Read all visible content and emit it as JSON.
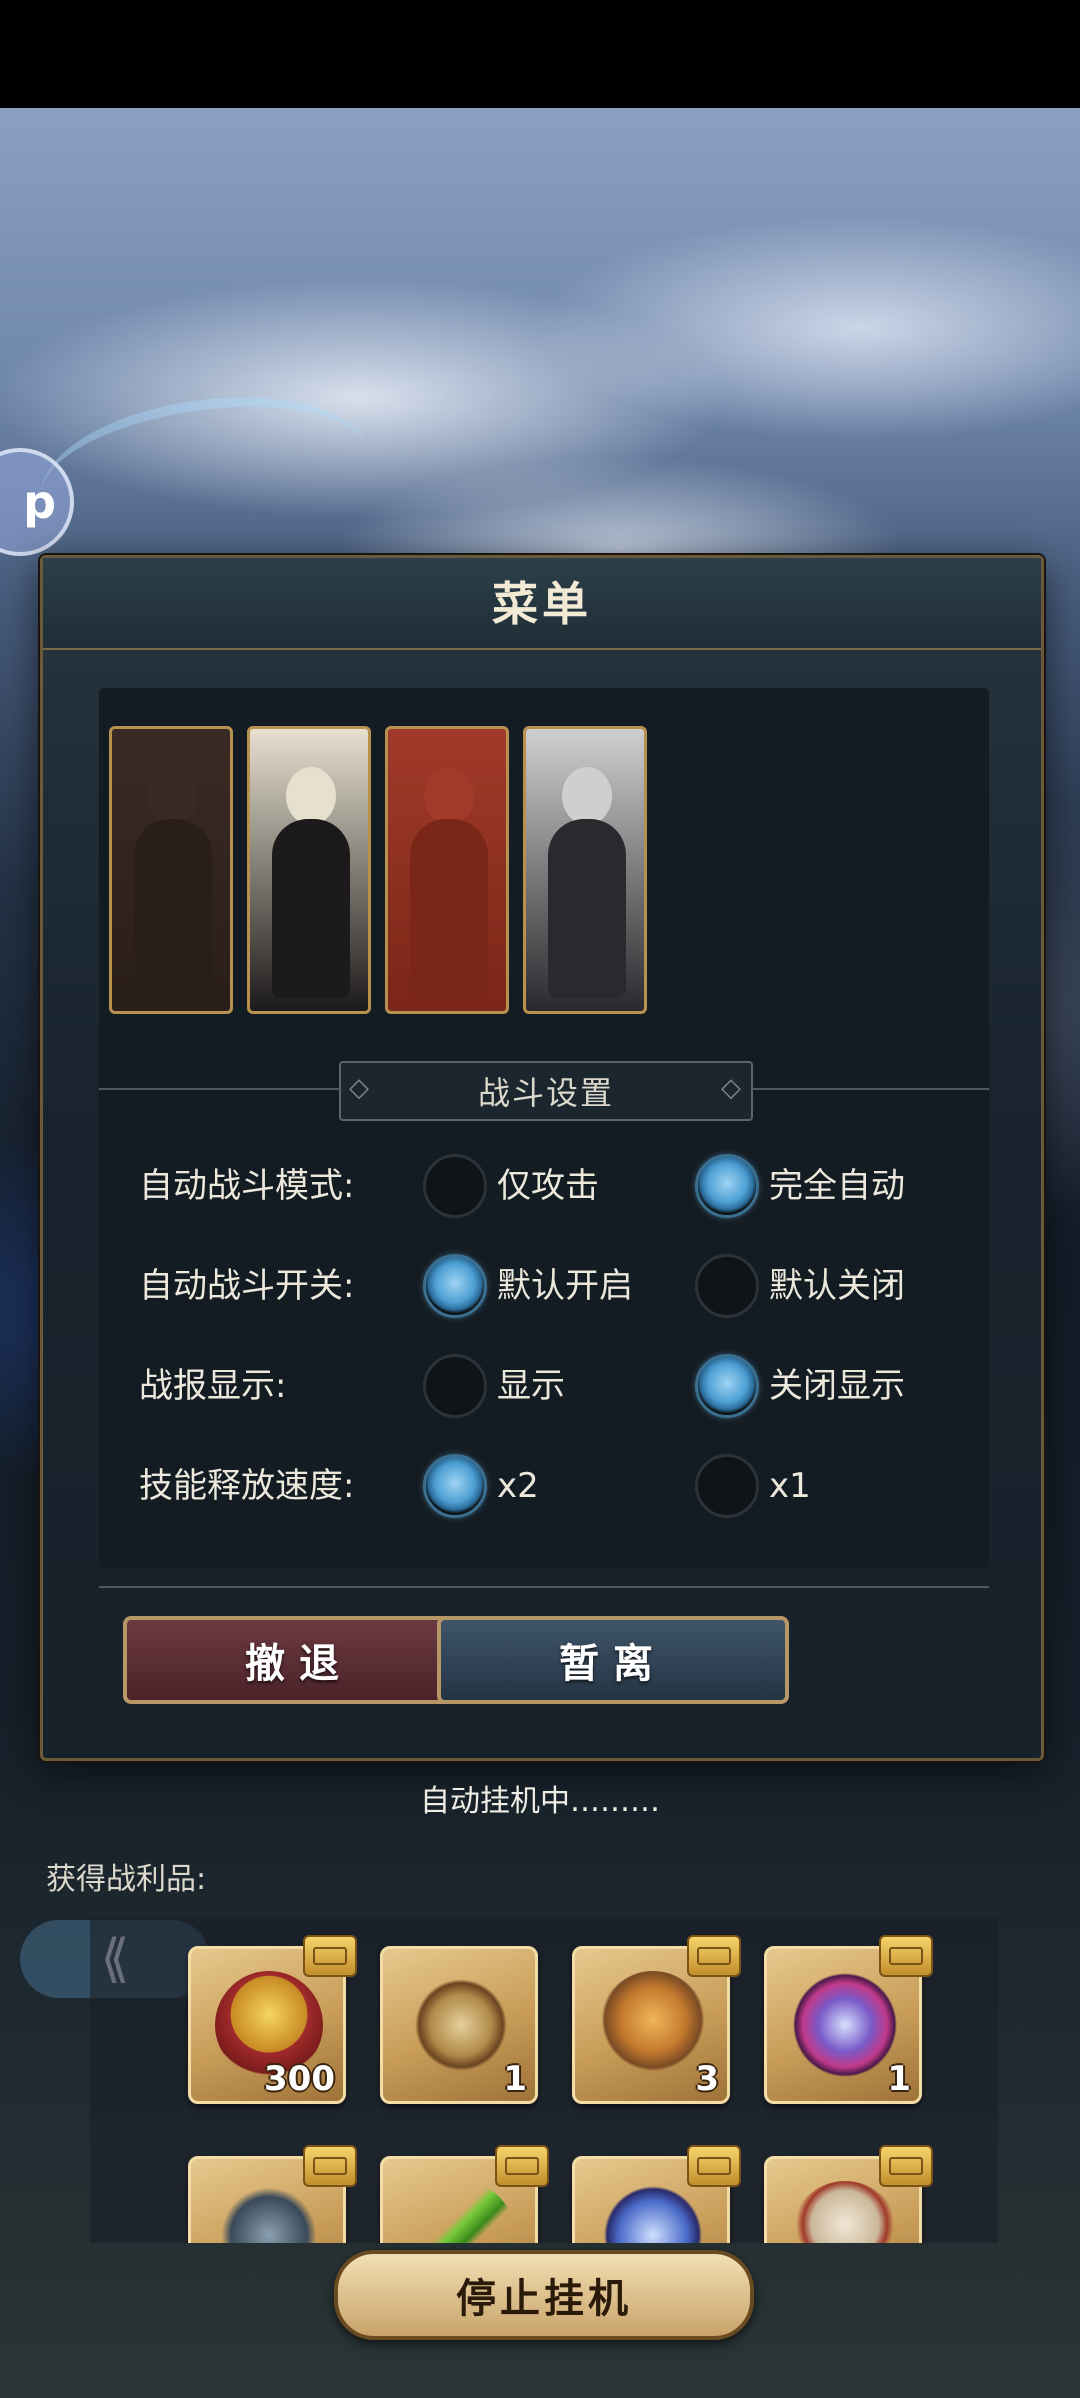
{
  "menu": {
    "title": "菜单"
  },
  "party": {
    "characters": [
      {
        "name": "character-1",
        "palette": [
          "#3a2a24",
          "#2a1e1a"
        ]
      },
      {
        "name": "character-2",
        "palette": [
          "#e6e0cf",
          "#1c1a1a"
        ]
      },
      {
        "name": "character-3",
        "palette": [
          "#a13a2a",
          "#7a2618"
        ]
      },
      {
        "name": "character-4",
        "palette": [
          "#cfcfcf",
          "#2a2a2e"
        ]
      }
    ]
  },
  "battle_settings": {
    "title": "战斗设置",
    "rows": [
      {
        "label": "自动战斗模式:",
        "options": [
          {
            "label": "仅攻击",
            "selected": false
          },
          {
            "label": "完全自动",
            "selected": true
          }
        ]
      },
      {
        "label": "自动战斗开关:",
        "options": [
          {
            "label": "默认开启",
            "selected": true
          },
          {
            "label": "默认关闭",
            "selected": false
          }
        ]
      },
      {
        "label": "战报显示:",
        "options": [
          {
            "label": "显示",
            "selected": false
          },
          {
            "label": "关闭显示",
            "selected": true
          }
        ]
      },
      {
        "label": "技能释放速度:",
        "options": [
          {
            "label": "x2",
            "selected": true
          },
          {
            "label": "x1",
            "selected": false
          }
        ]
      }
    ]
  },
  "buttons": {
    "retreat": "撤退",
    "leave": "暂离",
    "stop_idle": "停止挂机"
  },
  "status": {
    "auto_idle": "自动挂机中………"
  },
  "loot": {
    "label": "获得战利品:",
    "items": [
      {
        "icon": "medal-icon",
        "count": "300"
      },
      {
        "icon": "compass-icon",
        "count": "1"
      },
      {
        "icon": "food-basket-icon",
        "count": "3"
      },
      {
        "icon": "crystal-orb-icon",
        "count": "1"
      },
      {
        "icon": "dragon-orb-icon",
        "count": ""
      },
      {
        "icon": "green-blade-icon",
        "count": ""
      },
      {
        "icon": "blue-orb-icon",
        "count": ""
      },
      {
        "icon": "bone-relic-icon",
        "count": ""
      }
    ]
  },
  "colors": {
    "accent_gold": "#b8914f",
    "radio_on": "#4ea0d4"
  }
}
